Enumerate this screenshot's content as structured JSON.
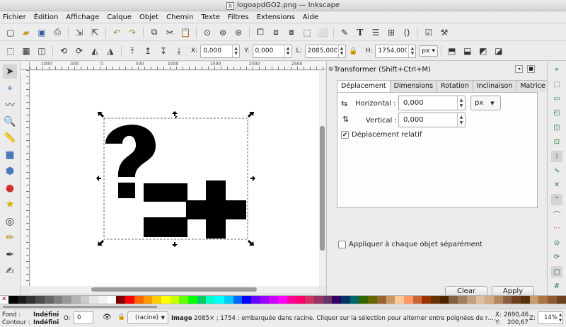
{
  "window": {
    "title": "logoapdGO2.png — Inkscape"
  },
  "menu": [
    "Fichier",
    "Édition",
    "Affichage",
    "Calque",
    "Objet",
    "Chemin",
    "Texte",
    "Filtres",
    "Extensions",
    "Aide"
  ],
  "toolbar1_icons": [
    "new-document-icon",
    "open-icon",
    "save-icon",
    "print-icon",
    "import-icon",
    "export-icon",
    "undo-icon",
    "redo-icon",
    "copy-icon",
    "cut-icon",
    "paste-icon",
    "zoom-selection-icon",
    "zoom-drawing-icon",
    "zoom-page-icon",
    "duplicate-icon",
    "clone-icon",
    "unlink-clone-icon",
    "group-icon",
    "ungroup-icon",
    "fill-stroke-icon",
    "text-font-icon",
    "layers-icon",
    "align-icon",
    "xml-editor-icon",
    "preferences-icon",
    "document-properties-icon"
  ],
  "coords": {
    "x": {
      "label": "X:",
      "value": "0,000"
    },
    "y": {
      "label": "Y:",
      "value": "0,000"
    },
    "w": {
      "label": "L:",
      "value": "2085,000"
    },
    "h": {
      "label": "H:",
      "value": "1754,000"
    },
    "unit": "px"
  },
  "tools": [
    "selector-arrow-icon",
    "node-edit-icon",
    "tweak-icon",
    "zoom-icon",
    "measure-icon",
    "rectangle-icon",
    "3d-box-icon",
    "ellipse-icon",
    "star-icon",
    "spiral-icon",
    "pencil-icon",
    "pen-icon",
    "calligraphy-icon"
  ],
  "ruler": {
    "marks": [
      "-1000",
      "-500",
      "0",
      "500",
      "1000",
      "1500",
      "2000",
      "2500"
    ]
  },
  "dock": {
    "title": "Transformer (Shift+Ctrl+M)",
    "tabs": [
      "Déplacement",
      "Dimensions",
      "Rotation",
      "Inclinaison",
      "Matrice"
    ],
    "active_tab": "Déplacement",
    "horizontal": {
      "label": "Horizontal :",
      "value": "0,000"
    },
    "vertical": {
      "label": "Vertical :",
      "value": "0,000"
    },
    "unit": "px",
    "relative_move": {
      "label": "Déplacement relatif",
      "checked": true
    },
    "apply_each": {
      "label": "Appliquer à chaque objet séparément",
      "checked": false
    },
    "clear_label": "Clear",
    "apply_label": "Apply"
  },
  "snaps": [
    "snap-enable-icon",
    "snap-bbox-icon",
    "snap-bbox-edge-icon",
    "snap-bbox-corner-icon",
    "snap-bbox-midpoint-icon",
    "snap-bbox-center-icon",
    "snap-nodes-icon",
    "snap-path-icon",
    "snap-intersection-icon",
    "snap-cusp-icon",
    "snap-smooth-icon",
    "snap-midpoint-icon",
    "snap-center-icon",
    "snap-rotation-icon",
    "snap-page-icon",
    "snap-grid-icon"
  ],
  "palette": [
    "#000000",
    "#1a1a1a",
    "#333333",
    "#4d4d4d",
    "#666666",
    "#808080",
    "#999999",
    "#b3b3b3",
    "#cccccc",
    "#e6e6e6",
    "#f2f2f2",
    "#ffffff",
    "#800000",
    "#ff0000",
    "#ff6600",
    "#ff9900",
    "#ffcc00",
    "#ffff00",
    "#ccff00",
    "#66ff00",
    "#00ff00",
    "#00cc66",
    "#00ffcc",
    "#00ffff",
    "#00ccff",
    "#0066ff",
    "#0000ff",
    "#6600ff",
    "#9900ff",
    "#cc00ff",
    "#ff00ff",
    "#ff0099",
    "#ff0066",
    "#cc3366",
    "#993366",
    "#663366",
    "#330066",
    "#003366",
    "#006666",
    "#336600",
    "#666600",
    "#996633",
    "#cc9966",
    "#ffcc99",
    "#ff9966",
    "#cc6633",
    "#993300",
    "#663300",
    "#4d2600",
    "#806040",
    "#a08060",
    "#c0a080",
    "#e0c0a0",
    "#d4aa88",
    "#b38860",
    "#8a6040",
    "#704020",
    "#5a3010",
    "#c69c6d",
    "#aa7744",
    "#8f5a2c",
    "#6e4220"
  ],
  "status": {
    "fill_label": "Fond :",
    "fill_value": "Indéfini",
    "stroke_label": "Contour :",
    "stroke_value": "Indéfini",
    "opacity_label": "O:",
    "opacity_value": "0",
    "layer": "(racine)",
    "message_bold": "Image",
    "message": " 2085× ; 1754 : embarquée dans racine. Cliquer sur la sélection pour alterner entre poignées de r…",
    "cursor_x_label": "X:",
    "cursor_x": "2690,46",
    "cursor_y_label": "Y:",
    "cursor_y": "200,67",
    "zoom_label": "Z:",
    "zoom": "14%"
  }
}
